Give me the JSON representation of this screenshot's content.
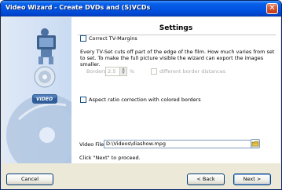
{
  "window": {
    "title": "Video Wizard - Create DVDs and (S)VCDs",
    "close_glyph": "✕"
  },
  "sidebar": {
    "video_badge": "VIDEO"
  },
  "settings": {
    "heading": "Settings",
    "correct_tv_margins": {
      "label": "Correct TV-Margins",
      "checked": false
    },
    "description": "Every TV-Set cuts off part of the edge of the film. How much varies from set to set. To make the full picture visible the wizard can export the images smaller.",
    "borders": {
      "label": "Borders:",
      "value": "2.5",
      "unit": "%",
      "enabled": false
    },
    "different_border_distances": {
      "label": "different border distances",
      "checked": false,
      "enabled": false
    },
    "aspect_ratio_correction": {
      "label": "Aspect ratio correction with colored borders",
      "checked": false
    },
    "video_file": {
      "label": "Video File:",
      "value": "D:\\Videos\\diashow.mpg"
    },
    "hint": "Click \"Next\" to proceed."
  },
  "buttons": {
    "cancel": "Cancel",
    "back": "< Back",
    "next": "Next >"
  },
  "colors": {
    "titlebar": "#0053e1",
    "sidebar": "#c9dbf2",
    "dialog_bg": "#ece9d8"
  }
}
